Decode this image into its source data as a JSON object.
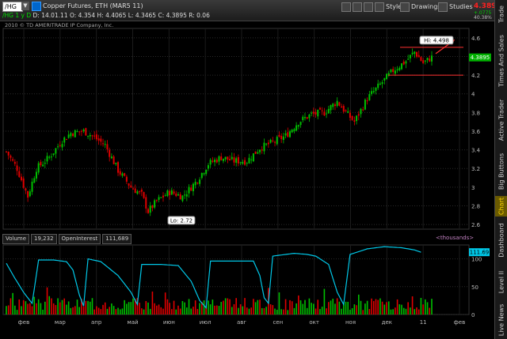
{
  "toolbar": {
    "symbol": "/HG",
    "title": "Copper Futures, ETH (MAR5 11)",
    "ohlc": {
      "period": "/HG 1 y D",
      "date": "D: 14.01.11",
      "open": "O: 4.354",
      "high": "H: 4.4065",
      "low": "L: 4.3465",
      "close": "C: 4.3895",
      "range": "R: 0.06"
    },
    "style_label": "Style",
    "drawings_label": "Drawings",
    "studies_label": "Studies",
    "last_price": "4.3895",
    "change_line1": "+.0775",
    "change_line2": "40.38%"
  },
  "sidebar_tabs": [
    "Trade",
    "Times And Sales",
    "Active Trader",
    "Big Buttons",
    "Chart",
    "Dashboard",
    "Level II",
    "Live News"
  ],
  "active_tab": "Chart",
  "copyright": "2010 © TD AMERITRADE IP Company, Inc.",
  "annotations": {
    "hi": "Hi: 4.498",
    "lo": "Lo: 2.72",
    "last_marker": "4.3895",
    "volume_last": "111.69"
  },
  "volume_header": {
    "volume_label": "Volume",
    "volume_value": "19,232",
    "oi_label": "OpenInterest",
    "oi_value": "111,689",
    "units": "<thousands>"
  },
  "colors": {
    "up": "#00c000",
    "down": "#e00000",
    "oi_line": "#00c8e8",
    "grid": "#2a2a2a",
    "marker_bg": "#00b000"
  },
  "chart_data": [
    {
      "type": "candlestick",
      "title": "",
      "x_labels": [
        "фев",
        "мар",
        "апр",
        "май",
        "июн",
        "июл",
        "авг",
        "сен",
        "окт",
        "ноя",
        "дек",
        "11",
        "фев"
      ],
      "ylim": [
        2.55,
        4.7
      ],
      "y_ticks": [
        "4.6",
        "4.4",
        "4.2",
        "4",
        "3.8",
        "3.6",
        "3.4",
        "3.2",
        "3",
        "2.8",
        "2.6"
      ],
      "close_path": [
        [
          0,
          3.38
        ],
        [
          5,
          3.2
        ],
        [
          10,
          2.9
        ],
        [
          14,
          3.2
        ],
        [
          20,
          3.32
        ],
        [
          26,
          3.5
        ],
        [
          30,
          3.58
        ],
        [
          36,
          3.6
        ],
        [
          40,
          3.55
        ],
        [
          46,
          3.45
        ],
        [
          52,
          3.18
        ],
        [
          58,
          3.0
        ],
        [
          63,
          2.92
        ],
        [
          66,
          2.74
        ],
        [
          70,
          2.85
        ],
        [
          76,
          2.95
        ],
        [
          82,
          2.9
        ],
        [
          88,
          3.05
        ],
        [
          94,
          3.25
        ],
        [
          100,
          3.32
        ],
        [
          106,
          3.28
        ],
        [
          112,
          3.28
        ],
        [
          118,
          3.42
        ],
        [
          124,
          3.48
        ],
        [
          130,
          3.55
        ],
        [
          136,
          3.7
        ],
        [
          142,
          3.78
        ],
        [
          148,
          3.8
        ],
        [
          154,
          3.92
        ],
        [
          158,
          3.8
        ],
        [
          162,
          3.7
        ],
        [
          168,
          3.95
        ],
        [
          174,
          4.1
        ],
        [
          180,
          4.25
        ],
        [
          186,
          4.35
        ],
        [
          190,
          4.45
        ],
        [
          194,
          4.33
        ],
        [
          198,
          4.39
        ]
      ],
      "hi": 4.498,
      "lo": 2.72,
      "last": 4.3895
    },
    {
      "type": "bar+line",
      "title": "",
      "series": [
        {
          "name": "Volume",
          "last": 19232
        },
        {
          "name": "OpenInterest",
          "last": 111689
        }
      ],
      "ylim": [
        0,
        125
      ],
      "y_ticks": [
        "100",
        "50",
        "0"
      ],
      "oi_path": [
        [
          0,
          92
        ],
        [
          4,
          65
        ],
        [
          8,
          40
        ],
        [
          12,
          20
        ],
        [
          15,
          98
        ],
        [
          22,
          98
        ],
        [
          28,
          95
        ],
        [
          31,
          80
        ],
        [
          34,
          35
        ],
        [
          36,
          15
        ],
        [
          38,
          100
        ],
        [
          44,
          95
        ],
        [
          52,
          70
        ],
        [
          58,
          40
        ],
        [
          61,
          18
        ],
        [
          63,
          90
        ],
        [
          72,
          90
        ],
        [
          80,
          88
        ],
        [
          86,
          60
        ],
        [
          90,
          25
        ],
        [
          93,
          12
        ],
        [
          95,
          96
        ],
        [
          105,
          96
        ],
        [
          115,
          96
        ],
        [
          118,
          70
        ],
        [
          120,
          30
        ],
        [
          122,
          20
        ],
        [
          124,
          105
        ],
        [
          134,
          110
        ],
        [
          140,
          108
        ],
        [
          144,
          105
        ],
        [
          150,
          90
        ],
        [
          154,
          40
        ],
        [
          157,
          18
        ],
        [
          160,
          108
        ],
        [
          168,
          118
        ],
        [
          176,
          122
        ],
        [
          184,
          120
        ],
        [
          190,
          116
        ],
        [
          193,
          112
        ]
      ]
    }
  ]
}
